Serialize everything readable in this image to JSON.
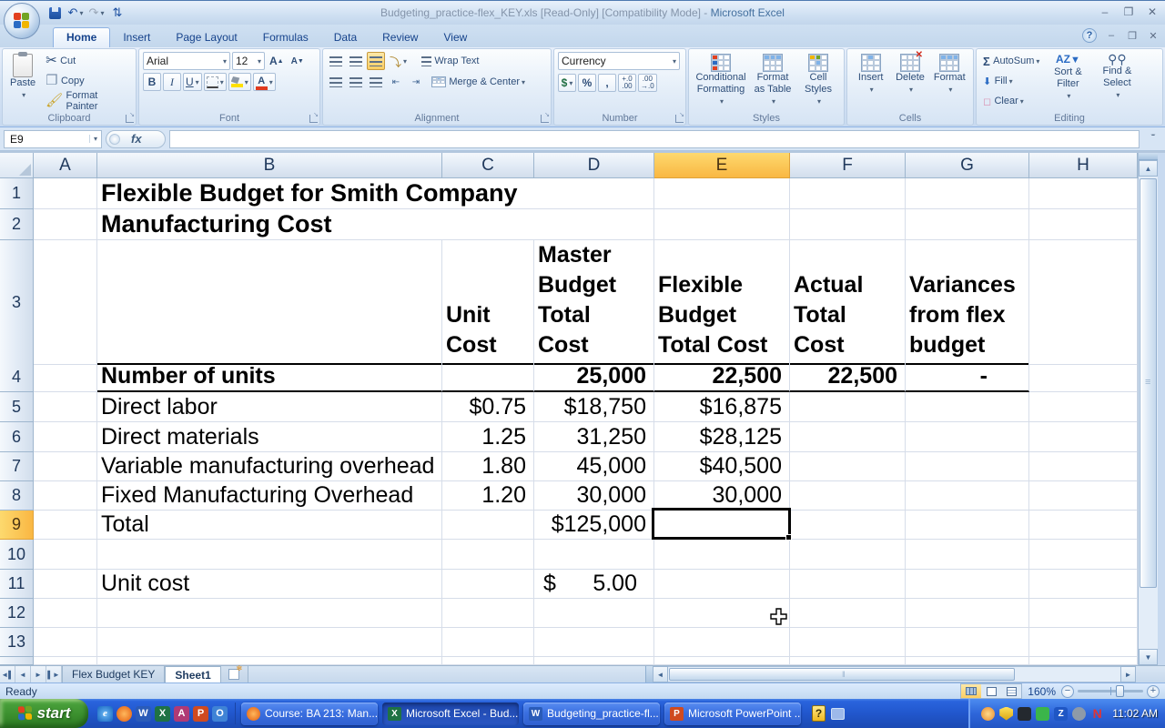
{
  "window": {
    "title_file": "Budgeting_practice-flex_KEY.xls  [Read-Only]  [Compatibility Mode] - ",
    "title_app": "Microsoft Excel"
  },
  "ribbon": {
    "tabs": [
      {
        "label": "Home",
        "active": true
      },
      {
        "label": "Insert"
      },
      {
        "label": "Page Layout"
      },
      {
        "label": "Formulas"
      },
      {
        "label": "Data"
      },
      {
        "label": "Review"
      },
      {
        "label": "View"
      }
    ],
    "clipboard": {
      "title": "Clipboard",
      "paste": "Paste",
      "cut": "Cut",
      "copy": "Copy",
      "format_painter": "Format Painter"
    },
    "font": {
      "title": "Font",
      "name": "Arial",
      "size": "12",
      "bold": "B",
      "italic": "I",
      "underline": "U",
      "letter_a": "A"
    },
    "alignment": {
      "title": "Alignment",
      "wrap": "Wrap Text",
      "merge": "Merge & Center"
    },
    "number": {
      "title": "Number",
      "format": "Currency",
      "dollar": "$",
      "percent": "%",
      "comma": ",",
      "inc_top": "+.0",
      "inc_bot": ".00",
      "dec_top": ".00",
      "dec_bot": "→.0"
    },
    "styles": {
      "title": "Styles",
      "conditional": "Conditional Formatting",
      "as_table": "Format as Table",
      "cell_styles": "Cell Styles"
    },
    "cells": {
      "title": "Cells",
      "insert": "Insert",
      "delete": "Delete",
      "format": "Format"
    },
    "editing": {
      "title": "Editing",
      "sigma": "Σ",
      "autosum": "AutoSum",
      "fill": "Fill",
      "clear": "Clear",
      "sort_filter": "Sort & Filter",
      "find_select": "Find & Select",
      "az": "A Z"
    }
  },
  "formula_bar": {
    "name_box": "E9",
    "fx": "fx",
    "content": ""
  },
  "grid": {
    "columns": [
      "A",
      "B",
      "C",
      "D",
      "E",
      "F",
      "G",
      "H"
    ],
    "rows": [
      "1",
      "2",
      "3",
      "4",
      "5",
      "6",
      "7",
      "8",
      "9",
      "10",
      "11",
      "12",
      "13"
    ],
    "selected_cell": "E9"
  },
  "sheet": {
    "r1_b": "Flexible Budget for Smith Company",
    "r2_b": "Manufacturing Cost",
    "r3": {
      "c": "Unit\nCost",
      "d": "Master\nBudget\nTotal\nCost",
      "e": "Flexible\nBudget\nTotal Cost",
      "f": "Actual\nTotal\nCost",
      "g": "Variances\nfrom flex\nbudget"
    },
    "r4": {
      "b": "Number of units",
      "d": "25,000",
      "e": "22,500",
      "f": "22,500",
      "g": "-"
    },
    "r5": {
      "b": "Direct labor",
      "c": "$0.75",
      "d": "$18,750",
      "e": "$16,875"
    },
    "r6": {
      "b": "Direct materials",
      "c": "1.25",
      "d": "31,250",
      "e": "$28,125"
    },
    "r7": {
      "b": "Variable manufacturing overhead",
      "c": "1.80",
      "d": "45,000",
      "e": "$40,500"
    },
    "r8": {
      "b": "Fixed Manufacturing Overhead",
      "c": "1.20",
      "d": "30,000",
      "e": "30,000"
    },
    "r9": {
      "b": "Total",
      "d": "$125,000"
    },
    "r11": {
      "b": "Unit cost",
      "d_symbol": "$",
      "d_value": "5.00"
    }
  },
  "sheet_tabs": {
    "tab1": "Flex Budget KEY",
    "tab2": "Sheet1"
  },
  "status_bar": {
    "mode": "Ready",
    "zoom": "160%"
  },
  "taskbar": {
    "start": "start",
    "quick_launch_icons": [
      "internet-explorer",
      "firefox",
      "word",
      "excel",
      "access",
      "powerpoint",
      "outlook"
    ],
    "ql_letters": {
      "ie": "e",
      "word": "W",
      "excel": "X",
      "access": "A",
      "powerpoint": "P",
      "outlook": "O"
    },
    "tasks": [
      {
        "label": "Course: BA 213: Man..."
      },
      {
        "label": "Microsoft Excel - Bud..."
      },
      {
        "label": "Budgeting_practice-fl..."
      },
      {
        "label": "Microsoft PowerPoint ..."
      }
    ],
    "help_glyph": "?",
    "tray_letters": {
      "z": "Z",
      "novell": "N"
    },
    "clock": "11:02 AM"
  },
  "colors": {
    "accent_amber": "#f9b743",
    "header_blue": "#d2deec",
    "taskbar_blue": "#2258cf",
    "start_green": "#3b8f2e"
  }
}
